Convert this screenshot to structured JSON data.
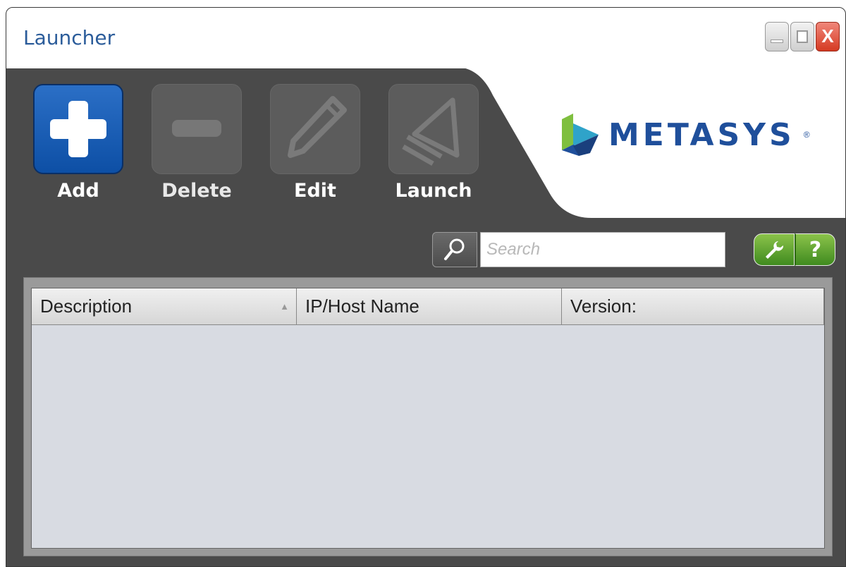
{
  "window": {
    "title": "Launcher"
  },
  "toolbar": {
    "add_label": "Add",
    "delete_label": "Delete",
    "edit_label": "Edit",
    "launch_label": "Launch"
  },
  "brand": {
    "logo_text": "METASYS",
    "registered_mark": "®"
  },
  "search": {
    "placeholder": "Search",
    "value": ""
  },
  "utility_buttons": {
    "help_label": "?"
  },
  "table": {
    "columns": [
      "Description",
      "IP/Host Name",
      "Version:"
    ],
    "rows": []
  },
  "colors": {
    "title_blue": "#2b5c9a",
    "active_button_blue": "#0d4fa5",
    "utility_green": "#3f8a1f",
    "close_red": "#d53a22",
    "table_bg": "#d8dbe2"
  }
}
